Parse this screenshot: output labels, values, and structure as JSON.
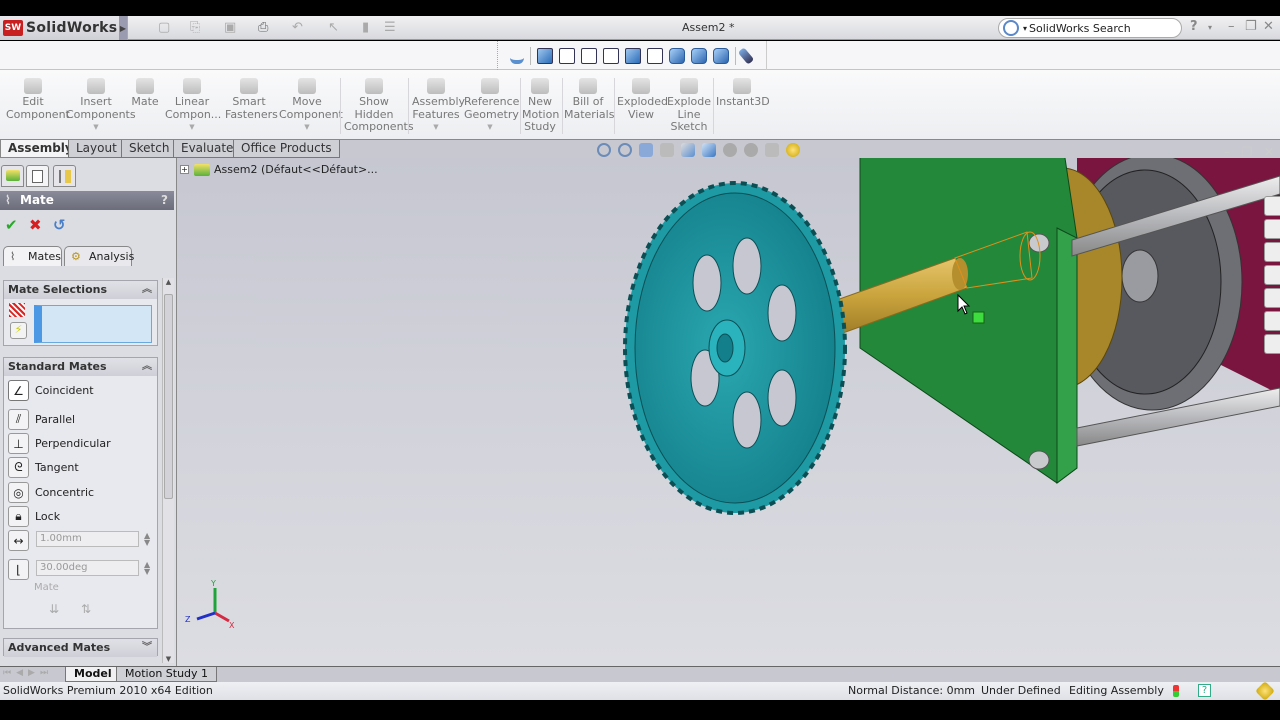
{
  "app": {
    "name": "SolidWorks",
    "logo_text": "SW"
  },
  "titlebar": {
    "document_title": "Assem2 *",
    "search_placeholder": "SolidWorks Search",
    "help_label": "?",
    "window_controls": [
      "minimize-icon",
      "restore-icon",
      "close-icon"
    ]
  },
  "quick_access": [
    "new-icon",
    "open-icon",
    "save-icon",
    "print-icon",
    "undo-icon",
    "select-icon",
    "rebuild-icon",
    "options-icon"
  ],
  "heads_up_views": [
    "normal-to",
    "front",
    "back",
    "left",
    "right",
    "top",
    "bottom",
    "isometric",
    "trimetric",
    "dimetric",
    "view-selector"
  ],
  "ribbon": {
    "buttons": [
      {
        "label": "Edit\nComponent",
        "icon": "edit-component-icon"
      },
      {
        "label": "Insert\nComponents",
        "icon": "insert-components-icon",
        "dropdown": true
      },
      {
        "label": "Mate",
        "icon": "mate-icon"
      },
      {
        "label": "Linear\nCompon...",
        "icon": "linear-pattern-icon",
        "dropdown": true
      },
      {
        "label": "Smart\nFasteners",
        "icon": "smart-fasteners-icon"
      },
      {
        "label": "Move\nComponent",
        "icon": "move-component-icon",
        "dropdown": true
      },
      {
        "label": "Show\nHidden\nComponents",
        "icon": "show-hidden-icon"
      },
      {
        "label": "Assembly\nFeatures",
        "icon": "assembly-features-icon",
        "dropdown": true
      },
      {
        "label": "Reference\nGeometry",
        "icon": "reference-geometry-icon",
        "dropdown": true
      },
      {
        "label": "New\nMotion\nStudy",
        "icon": "motion-study-icon"
      },
      {
        "label": "Bill of\nMaterials",
        "icon": "bom-icon"
      },
      {
        "label": "Exploded\nView",
        "icon": "exploded-view-icon"
      },
      {
        "label": "Explode\nLine\nSketch",
        "icon": "explode-line-icon"
      },
      {
        "label": "Instant3D",
        "icon": "instant3d-icon"
      }
    ]
  },
  "command_tabs": [
    {
      "label": "Assembly",
      "active": true
    },
    {
      "label": "Layout"
    },
    {
      "label": "Sketch"
    },
    {
      "label": "Evaluate"
    },
    {
      "label": "Office Products"
    }
  ],
  "property_manager": {
    "title": "Mate",
    "help": "?",
    "subtabs": [
      "Mates",
      "Analysis"
    ],
    "mate_selections": {
      "header": "Mate Selections",
      "value": ""
    },
    "standard_mates": {
      "header": "Standard Mates",
      "items": [
        "Coincident",
        "Parallel",
        "Perpendicular",
        "Tangent",
        "Concentric",
        "Lock"
      ],
      "distance": "1.00mm",
      "angle": "30.00deg",
      "mate_alignment_label": "Mate"
    },
    "advanced_mates": {
      "header": "Advanced Mates"
    }
  },
  "tree": {
    "root": "Assem2  (Défaut<<Défaut>..."
  },
  "viewport": {
    "colors": {
      "gear": "#2bb3bd",
      "shaft": "#c9a33c",
      "plate": "#23883a",
      "background_plate": "#7a1540",
      "rods": "#b8b9bd"
    },
    "triad": {
      "x": "X",
      "y": "Y",
      "z": "Z"
    }
  },
  "bottom_tabs": [
    {
      "label": "Model",
      "active": true
    },
    {
      "label": "Motion Study 1"
    }
  ],
  "status": {
    "edition": "SolidWorks Premium 2010 x64 Edition",
    "normal_distance": "Normal Distance: 0mm",
    "definition": "Under Defined",
    "mode": "Editing Assembly"
  }
}
